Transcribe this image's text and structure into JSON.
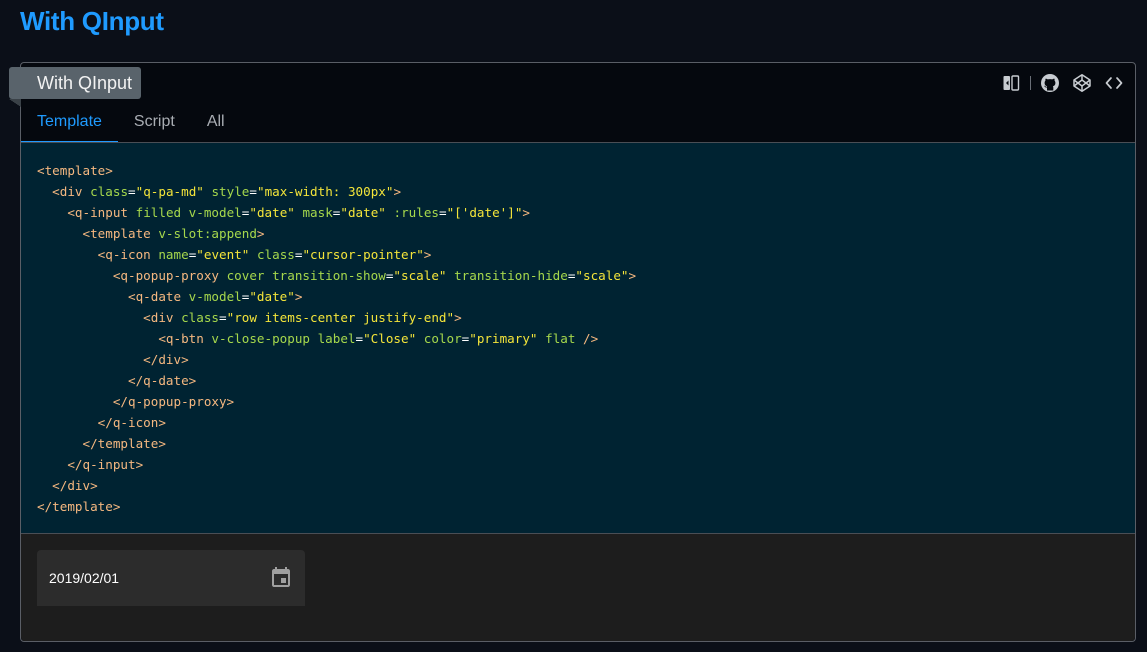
{
  "page": {
    "heading": "With QInput"
  },
  "card": {
    "title": "With QInput",
    "toolbar_icons": [
      "flip-icon",
      "github-icon",
      "codepen-icon",
      "code-icon"
    ],
    "tabs": [
      {
        "label": "Template",
        "active": true
      },
      {
        "label": "Script",
        "active": false
      },
      {
        "label": "All",
        "active": false
      }
    ]
  },
  "code": {
    "lines": [
      [
        [
          "tag",
          "<template>"
        ]
      ],
      [
        [
          "txt",
          "  "
        ],
        [
          "tag",
          "<div"
        ],
        [
          "txt",
          " "
        ],
        [
          "attr",
          "class"
        ],
        [
          "punc",
          "="
        ],
        [
          "str",
          "\"q-pa-md\""
        ],
        [
          "txt",
          " "
        ],
        [
          "attr",
          "style"
        ],
        [
          "punc",
          "="
        ],
        [
          "str",
          "\"max-width: 300px\""
        ],
        [
          "tag",
          ">"
        ]
      ],
      [
        [
          "txt",
          "    "
        ],
        [
          "tag",
          "<q-input"
        ],
        [
          "txt",
          " "
        ],
        [
          "attr",
          "filled v-model"
        ],
        [
          "punc",
          "="
        ],
        [
          "str",
          "\"date\""
        ],
        [
          "txt",
          " "
        ],
        [
          "attr",
          "mask"
        ],
        [
          "punc",
          "="
        ],
        [
          "str",
          "\"date\""
        ],
        [
          "txt",
          " "
        ],
        [
          "attr",
          ":rules"
        ],
        [
          "punc",
          "="
        ],
        [
          "str",
          "\"['date']\""
        ],
        [
          "tag",
          ">"
        ]
      ],
      [
        [
          "txt",
          "      "
        ],
        [
          "tag",
          "<template"
        ],
        [
          "txt",
          " "
        ],
        [
          "attr",
          "v-slot:append"
        ],
        [
          "tag",
          ">"
        ]
      ],
      [
        [
          "txt",
          "        "
        ],
        [
          "tag",
          "<q-icon"
        ],
        [
          "txt",
          " "
        ],
        [
          "attr",
          "name"
        ],
        [
          "punc",
          "="
        ],
        [
          "str",
          "\"event\""
        ],
        [
          "txt",
          " "
        ],
        [
          "attr",
          "class"
        ],
        [
          "punc",
          "="
        ],
        [
          "str",
          "\"cursor-pointer\""
        ],
        [
          "tag",
          ">"
        ]
      ],
      [
        [
          "txt",
          "          "
        ],
        [
          "tag",
          "<q-popup-proxy"
        ],
        [
          "txt",
          " "
        ],
        [
          "attr",
          "cover transition-show"
        ],
        [
          "punc",
          "="
        ],
        [
          "str",
          "\"scale\""
        ],
        [
          "txt",
          " "
        ],
        [
          "attr",
          "transition-hide"
        ],
        [
          "punc",
          "="
        ],
        [
          "str",
          "\"scale\""
        ],
        [
          "tag",
          ">"
        ]
      ],
      [
        [
          "txt",
          "            "
        ],
        [
          "tag",
          "<q-date"
        ],
        [
          "txt",
          " "
        ],
        [
          "attr",
          "v-model"
        ],
        [
          "punc",
          "="
        ],
        [
          "str",
          "\"date\""
        ],
        [
          "tag",
          ">"
        ]
      ],
      [
        [
          "txt",
          "              "
        ],
        [
          "tag",
          "<div"
        ],
        [
          "txt",
          " "
        ],
        [
          "attr",
          "class"
        ],
        [
          "punc",
          "="
        ],
        [
          "str",
          "\"row items-center justify-end\""
        ],
        [
          "tag",
          ">"
        ]
      ],
      [
        [
          "txt",
          "                "
        ],
        [
          "tag",
          "<q-btn"
        ],
        [
          "txt",
          " "
        ],
        [
          "attr",
          "v-close-popup label"
        ],
        [
          "punc",
          "="
        ],
        [
          "str",
          "\"Close\""
        ],
        [
          "txt",
          " "
        ],
        [
          "attr",
          "color"
        ],
        [
          "punc",
          "="
        ],
        [
          "str",
          "\"primary\""
        ],
        [
          "txt",
          " "
        ],
        [
          "attr",
          "flat"
        ],
        [
          "txt",
          " "
        ],
        [
          "tag",
          "/>"
        ]
      ],
      [
        [
          "txt",
          "              "
        ],
        [
          "tag",
          "</div>"
        ]
      ],
      [
        [
          "txt",
          "            "
        ],
        [
          "tag",
          "</q-date>"
        ]
      ],
      [
        [
          "txt",
          "          "
        ],
        [
          "tag",
          "</q-popup-proxy>"
        ]
      ],
      [
        [
          "txt",
          "        "
        ],
        [
          "tag",
          "</q-icon>"
        ]
      ],
      [
        [
          "txt",
          "      "
        ],
        [
          "tag",
          "</template>"
        ]
      ],
      [
        [
          "txt",
          "    "
        ],
        [
          "tag",
          "</q-input>"
        ]
      ],
      [
        [
          "txt",
          "  "
        ],
        [
          "tag",
          "</div>"
        ]
      ],
      [
        [
          "tag",
          "</template>"
        ]
      ]
    ]
  },
  "demo": {
    "date_value": "2019/02/01",
    "append_icon": "calendar-event-icon"
  },
  "colors": {
    "accent": "#1f9bff",
    "code_bg": "#002332",
    "tag": "#f5b880",
    "attr": "#a6d84c",
    "string": "#f4e53a"
  }
}
